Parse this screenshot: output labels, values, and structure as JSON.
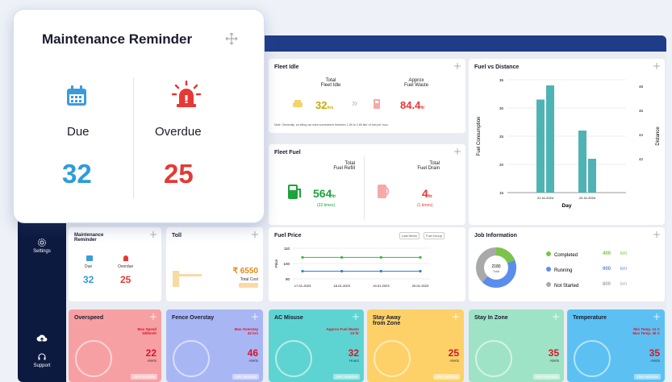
{
  "big_card": {
    "title": "Maintenance Reminder",
    "due_label": "Due",
    "due_value": "32",
    "overdue_label": "Overdue",
    "overdue_value": "25"
  },
  "sidebar": {
    "settings": "Settings",
    "support": "Support"
  },
  "fleet_idle": {
    "title": "Fleet Idle",
    "total_label_1": "Total",
    "total_label_2": "Fleet Idle",
    "approx_label_1": "Approx",
    "approx_label_2": "Fuel Waste",
    "idle_value": "32",
    "idle_unit": "hrs",
    "waste_value": "84.4",
    "waste_unit": "ltr",
    "note": "Note: Generally, an idling car uses somewhere between 1.89 to 2.65 liter of fuel per hour."
  },
  "fleet_fuel": {
    "title": "Fleet Fuel",
    "refill_label_1": "Total",
    "refill_label_2": "Fuel Refill",
    "drain_label_1": "Total",
    "drain_label_2": "Fuel Drain",
    "refill_value": "564",
    "refill_unit": "ltr",
    "refill_times": "(32 times)",
    "drain_value": "4",
    "drain_unit": "ltr",
    "drain_times": "(1 times)"
  },
  "fuel_vs_distance": {
    "title": "Fuel vs Distance"
  },
  "mini_maintenance": {
    "title_1": "Maintenance",
    "title_2": "Reminder",
    "due_label": "Due",
    "overdue_label": "Overdue",
    "due_value": "32",
    "overdue_value": "25"
  },
  "toll": {
    "title": "Toll",
    "value": "₹ 6550",
    "sub": "Total Cost"
  },
  "fuel_price": {
    "title": "Fuel Price",
    "btn1": "Last Week",
    "btn2": "Fuel Group"
  },
  "job_info": {
    "title": "Job Information",
    "center_value": "2180",
    "center_label": "Total",
    "items": [
      {
        "label": "Completed",
        "value": "400",
        "unit": "km",
        "color": "#7cc34a"
      },
      {
        "label": "Running",
        "value": "900",
        "unit": "km",
        "color": "#5b8def"
      },
      {
        "label": "Not Started",
        "value": "800",
        "unit": "km",
        "color": "#a9a9a9"
      }
    ]
  },
  "bottom_cards": [
    {
      "title": "Overspeed",
      "line1": "Max Speed",
      "line2": "160km/h",
      "value": "22",
      "label": "Alerts",
      "pill": "15% vehicles",
      "color": "#f7a0a4"
    },
    {
      "title": "Fence Overstay",
      "line1": "Max Overstay",
      "line2": "32 hrs",
      "value": "46",
      "label": "Alerts",
      "pill": "16% vehicles",
      "color": "#a9b6f4"
    },
    {
      "title": "AC Misuse",
      "line1": "Approx Fuel Waste",
      "line2": "23 ltr",
      "value": "32",
      "label": "Hours",
      "pill": "15% vehicles",
      "color": "#5ed4d2"
    },
    {
      "title": "Stay Away",
      "title2": "from Zone",
      "line1": "",
      "line2": "",
      "value": "25",
      "label": "Alerts",
      "pill": "15% vehicles",
      "color": "#fdd167"
    },
    {
      "title": "Stay In Zone",
      "line1": "",
      "line2": "",
      "value": "35",
      "label": "Alerts",
      "pill": "15% vehicles",
      "color": "#9fe3c6"
    },
    {
      "title": "Temperature",
      "line1": "Min Temp. 12 C",
      "line2": "Max Temp. 46 C",
      "value": "35",
      "label": "Alerts",
      "pill": "15% vehicles",
      "color": "#5cc1f2"
    }
  ],
  "chart_data": [
    {
      "type": "bar",
      "title": "Fuel vs Distance",
      "xlabel": "Day",
      "ylabel": "Fuel Consumption",
      "y2label": "Distance",
      "categories": [
        "21-11-2024",
        "22-11-2024"
      ],
      "series": [
        {
          "values": [
            31.5,
            26
          ],
          "values2": [
            34,
            21
          ]
        }
      ],
      "ylim": [
        15,
        35
      ],
      "y_ticks": [
        15,
        20,
        25,
        30,
        "35"
      ],
      "y2_ticks": [
        "42",
        "44",
        "46",
        "48"
      ]
    },
    {
      "type": "line",
      "title": "Fuel Price",
      "ylabel": "Price",
      "categories": [
        "17-01-2023",
        "18-01-2023",
        "19-01-2023",
        "20-01-2023"
      ],
      "series": [
        {
          "values": [
            104,
            104,
            104,
            104
          ],
          "color": "#3bb44a"
        },
        {
          "values": [
            95,
            95,
            95,
            95
          ],
          "color": "#2d7fd6"
        }
      ],
      "ylim": [
        90,
        110
      ],
      "y_ticks": [
        90,
        100,
        110
      ]
    }
  ]
}
